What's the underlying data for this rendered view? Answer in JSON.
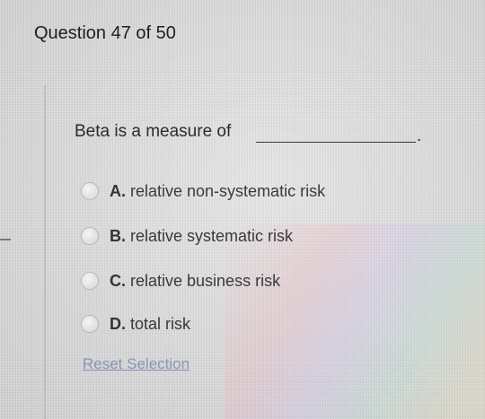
{
  "header": {
    "title": "Question 47 of 50"
  },
  "question": {
    "prompt": "Beta is a measure of",
    "blank_punctuation": "."
  },
  "options": [
    {
      "letter": "A.",
      "text": "relative non-systematic risk"
    },
    {
      "letter": "B.",
      "text": "relative systematic risk"
    },
    {
      "letter": "C.",
      "text": "relative business risk"
    },
    {
      "letter": "D.",
      "text": "total risk"
    }
  ],
  "reset": {
    "label": "Reset Selection"
  },
  "colors": {
    "background": "#dcdcdc",
    "text": "#2a2a2a",
    "link": "#8a94b5"
  }
}
